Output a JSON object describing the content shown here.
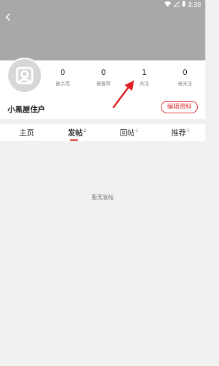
{
  "status_bar": {
    "time": "3:38"
  },
  "profile": {
    "username": "小黑屋住户",
    "edit_button": "编辑资料",
    "stats": [
      {
        "value": "0",
        "label": "被点亮"
      },
      {
        "value": "0",
        "label": "被推荐"
      },
      {
        "value": "1",
        "label": "关注"
      },
      {
        "value": "0",
        "label": "被关注"
      }
    ]
  },
  "tabs": [
    {
      "label": "主页",
      "count": ""
    },
    {
      "label": "发帖",
      "count": "2"
    },
    {
      "label": "回帖",
      "count": "2"
    },
    {
      "label": "推荐",
      "count": "0"
    }
  ],
  "empty_state": {
    "message": "暂无发帖"
  },
  "colors": {
    "accent": "#dd3333",
    "header_bg": "#a8a8a8"
  }
}
